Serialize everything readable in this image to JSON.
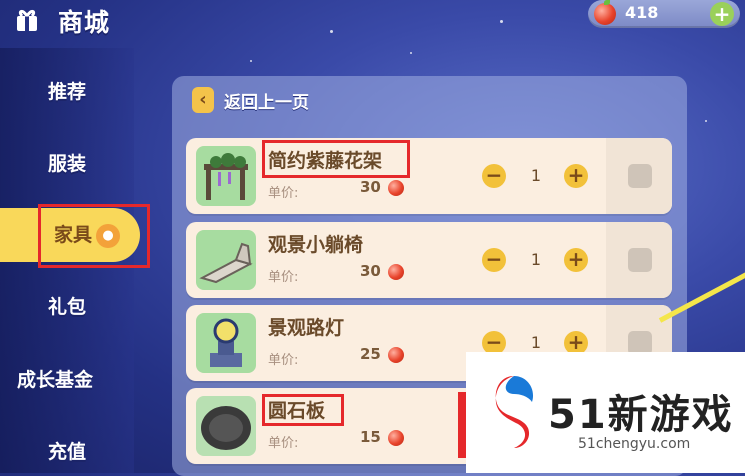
{
  "header": {
    "title": "商城",
    "icon": "gift-icon"
  },
  "currency": {
    "amount": "418",
    "icon": "apple-coin-icon",
    "add_label": "+"
  },
  "sidebar": {
    "items": [
      {
        "label": "推荐"
      },
      {
        "label": "服装"
      },
      {
        "label": "家具",
        "active": true
      },
      {
        "label": "礼包"
      },
      {
        "label": "成长基金"
      },
      {
        "label": "充值"
      }
    ]
  },
  "main": {
    "back_label": "返回上一页",
    "items": [
      {
        "name": "简约紫藤花架",
        "price_label": "单价:",
        "price": "30",
        "quantity": "1"
      },
      {
        "name": "观景小躺椅",
        "price_label": "单价:",
        "price": "30",
        "quantity": "1"
      },
      {
        "name": "景观路灯",
        "price_label": "单价:",
        "price": "25",
        "quantity": "1"
      },
      {
        "name": "圆石板",
        "price_label": "单价:",
        "price": "15"
      }
    ],
    "minus_label": "−",
    "plus_label": "+"
  },
  "watermark": {
    "title": "51新游戏",
    "url": "51chengyu.com"
  },
  "colors": {
    "accent": "#f9d85a",
    "highlight_box": "#e5282b",
    "background": "#3a4aa8"
  }
}
